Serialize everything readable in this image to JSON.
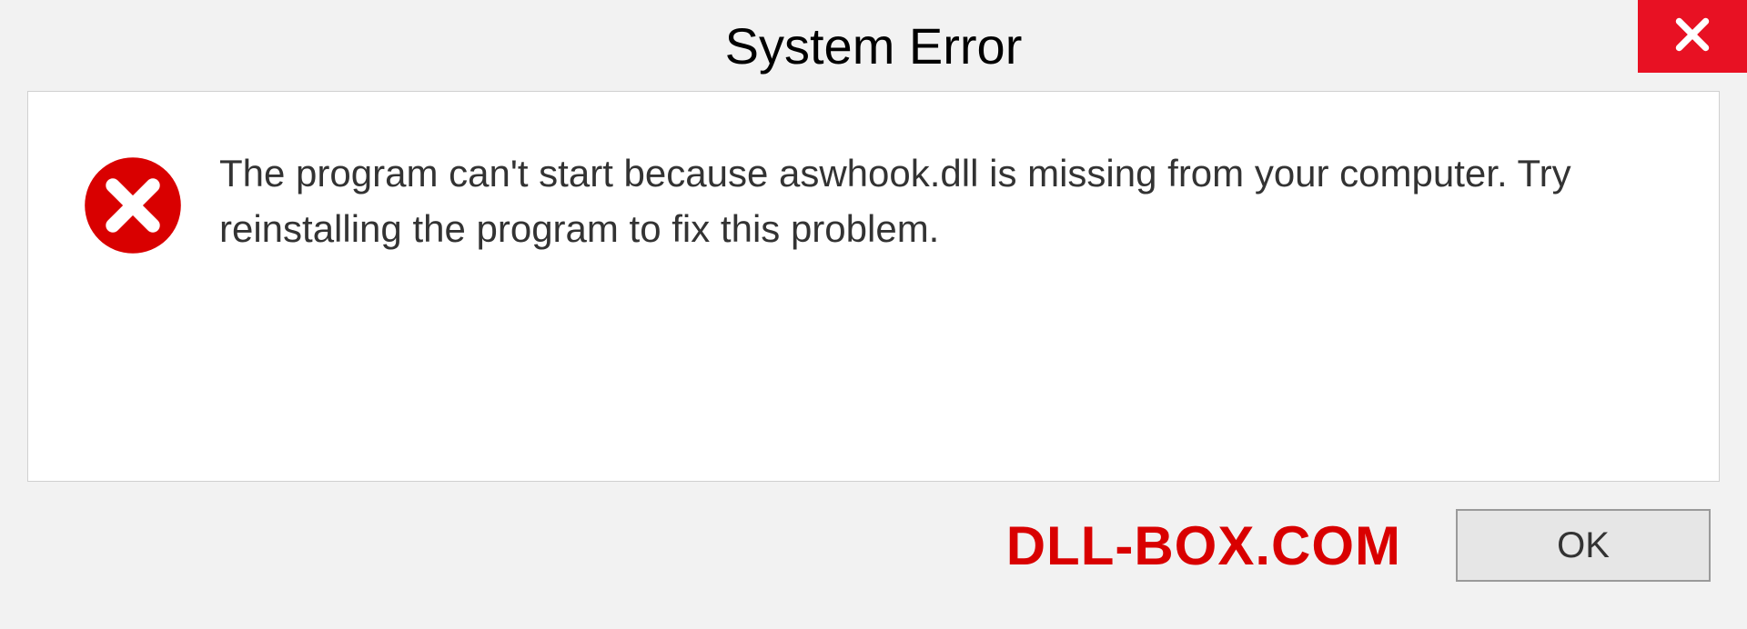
{
  "dialog": {
    "title": "System Error",
    "message": "The program can't start because aswhook.dll is missing from your computer. Try reinstalling the program to fix this problem.",
    "ok_label": "OK"
  },
  "watermark": "DLL-BOX.COM"
}
